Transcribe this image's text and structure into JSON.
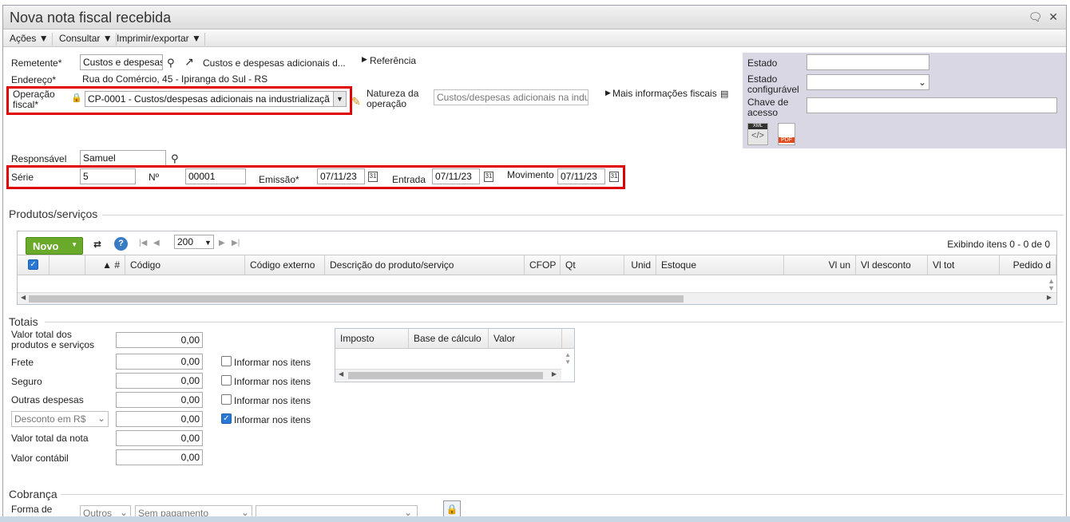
{
  "window": {
    "title": "Nova nota fiscal recebida"
  },
  "menubar": {
    "items": [
      "Ações",
      "Consultar",
      "Imprimir/exportar"
    ]
  },
  "remetente": {
    "label": "Remetente*",
    "value": "Custos e despesas",
    "link_text": "Custos e despesas adicionais d...",
    "referencia": "Referência"
  },
  "endereco": {
    "label": "Endereço*",
    "value": "Rua do Comércio, 45 - Ipiranga do Sul - RS"
  },
  "operacao": {
    "label_1": "Operação",
    "label_2": "fiscal*",
    "value": "CP-0001 - Custos/despesas adicionais na industrializaçã"
  },
  "natureza": {
    "label_1": "Natureza da",
    "label_2": "operação",
    "value": "Custos/despesas adicionais na indu"
  },
  "mais_info": "Mais informações fiscais",
  "estado": {
    "label": "Estado",
    "value": ""
  },
  "estado_config": {
    "label_1": "Estado",
    "label_2": "configurável",
    "value": ""
  },
  "chave": {
    "label_1": "Chave de",
    "label_2": "acesso",
    "value": ""
  },
  "file_icons": {
    "xml": "XML",
    "pdf": "PDF"
  },
  "responsavel": {
    "label": "Responsável",
    "value": "Samuel"
  },
  "serie": {
    "label": "Série",
    "value": "5"
  },
  "numero": {
    "label": "Nº",
    "value": "00001"
  },
  "emissao": {
    "label": "Emissão*",
    "value": "07/11/23"
  },
  "entrada": {
    "label": "Entrada",
    "value": "07/11/23"
  },
  "movimento": {
    "label": "Movimento",
    "value": "07/11/23"
  },
  "produtos": {
    "section_title": "Produtos/serviços",
    "novo_label": "Novo",
    "page_size": "200",
    "status": "Exibindo itens 0 - 0 de 0",
    "columns": [
      "▲ #",
      "Código",
      "Código externo",
      "Descrição do produto/serviço",
      "CFOP",
      "Qt",
      "Unid",
      "Estoque",
      "Vl un",
      "Vl desconto",
      "Vl tot",
      "Pedido d"
    ]
  },
  "totais": {
    "section_title": "Totais",
    "valor_total_label_1": "Valor total dos",
    "valor_total_label_2": "produtos e serviços",
    "valor_total": "0,00",
    "frete_label": "Frete",
    "frete": "0,00",
    "seguro_label": "Seguro",
    "seguro": "0,00",
    "outras_label": "Outras despesas",
    "outras": "0,00",
    "desconto_select": "Desconto em R$",
    "desconto": "0,00",
    "total_nota_label": "Valor total da nota",
    "total_nota": "0,00",
    "contabil_label": "Valor contábil",
    "contabil": "0,00",
    "informar_label": "Informar nos itens"
  },
  "impostos": {
    "columns": [
      "Imposto",
      "Base de cálculo",
      "Valor"
    ]
  },
  "cobranca": {
    "section_title": "Cobrança",
    "forma_label": "Forma de",
    "forma_select": "Outros",
    "pagamento_select": "Sem pagamento",
    "third_select": ""
  },
  "colors": {
    "accent_green": "#6aaa2a",
    "highlight_red": "#e00000",
    "panel": "#d9d7e4"
  }
}
